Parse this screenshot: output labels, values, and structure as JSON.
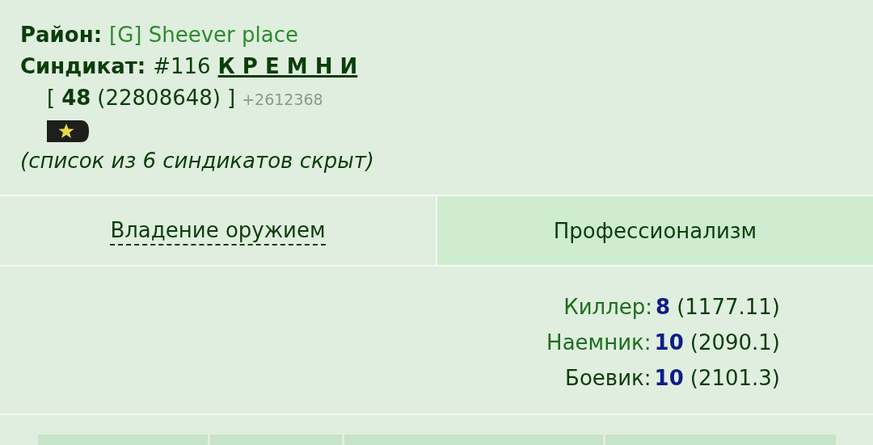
{
  "district": {
    "label": "Район:",
    "value": "[G] Sheever place"
  },
  "syndicate": {
    "label": "Синдикат:",
    "number": "#116",
    "name": "К Р Е М Н И",
    "open_bracket": "[",
    "level": "48",
    "points": "(22808648)",
    "close_bracket": "]",
    "gain": "+2612368"
  },
  "hidden_note": "(список из 6 синдикатов скрыт)",
  "tabs": [
    {
      "label": "Владение оружием",
      "selected": false
    },
    {
      "label": "Профессионализм",
      "selected": true
    }
  ],
  "professions": [
    {
      "name": "Киллер:",
      "color": "#1e6e1e",
      "level": "8",
      "points": "(1177.11)"
    },
    {
      "name": "Наемник:",
      "color": "#1e6e1e",
      "level": "10",
      "points": "(2090.1)"
    },
    {
      "name": "Боевик:",
      "color": "#0b3d0b",
      "level": "10",
      "points": "(2101.3)"
    }
  ]
}
